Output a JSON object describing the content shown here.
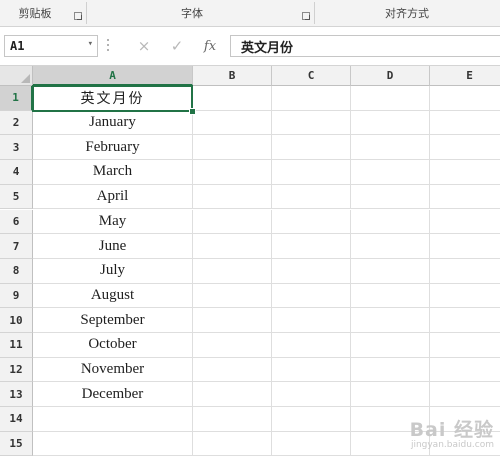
{
  "ribbon": {
    "groups": [
      {
        "label": "剪贴板"
      },
      {
        "label": "字体"
      },
      {
        "label": "对齐方式"
      }
    ]
  },
  "formula_bar": {
    "name_box": "A1",
    "cancel_icon": "×",
    "enter_icon": "✓",
    "fx_label": "fx",
    "content": "英文月份"
  },
  "sheet": {
    "columns": [
      "A",
      "B",
      "C",
      "D",
      "E"
    ],
    "rows": [
      "1",
      "2",
      "3",
      "4",
      "5",
      "6",
      "7",
      "8",
      "9",
      "10",
      "11",
      "12",
      "13",
      "14",
      "15"
    ],
    "column_a": [
      "英文月份",
      "January",
      "February",
      "March",
      "April",
      "May",
      "June",
      "July",
      "August",
      "September",
      "October",
      "November",
      "December",
      "",
      ""
    ],
    "selected_cell": "A1"
  },
  "watermark": {
    "main": "Bai 经验",
    "sub": "jingyan.baidu.com"
  },
  "colors": {
    "accent": "#217346",
    "header_bg": "#f2f2f2",
    "gridline": "#dedede"
  }
}
